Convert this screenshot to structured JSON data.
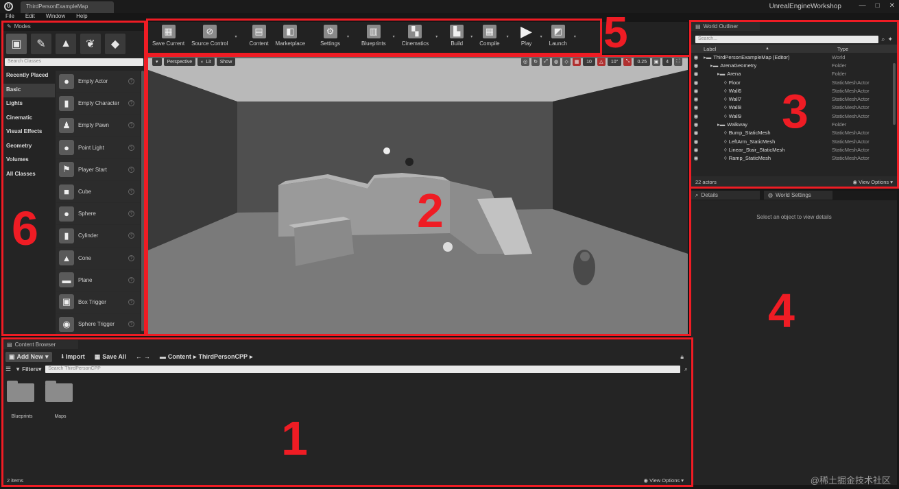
{
  "window": {
    "doc_tab": "ThirdPersonExampleMap",
    "title": "UnrealEngineWorkshop",
    "controls": [
      "—",
      "□",
      "✕"
    ]
  },
  "menu": [
    "File",
    "Edit",
    "Window",
    "Help"
  ],
  "modes": {
    "tab_label": "Modes",
    "search_placeholder": "Search Classes",
    "categories": [
      "Recently Placed",
      "Basic",
      "Lights",
      "Cinematic",
      "Visual Effects",
      "Geometry",
      "Volumes",
      "All Classes"
    ],
    "items": [
      "Empty Actor",
      "Empty Character",
      "Empty Pawn",
      "Point Light",
      "Player Start",
      "Cube",
      "Sphere",
      "Cylinder",
      "Cone",
      "Plane",
      "Box Trigger",
      "Sphere Trigger"
    ]
  },
  "toolbar": {
    "items": [
      "Save Current",
      "Source Control",
      "Content",
      "Marketplace",
      "Settings",
      "Blueprints",
      "Cinematics",
      "Build",
      "Compile",
      "Play",
      "Launch"
    ]
  },
  "viewport": {
    "perspective": "Perspective",
    "lit": "Lit",
    "show": "Show",
    "grid_snap": "10",
    "rot_snap": "10°",
    "scale_snap": "0.25",
    "camera_speed": "4"
  },
  "outliner": {
    "tab_label": "World Outliner",
    "search_placeholder": "Search...",
    "col_label": "Label",
    "col_type": "Type",
    "rows": [
      {
        "label": "ThirdPersonExampleMap (Editor)",
        "type": "World",
        "indent": 0
      },
      {
        "label": "ArenaGeometry",
        "type": "Folder",
        "indent": 1
      },
      {
        "label": "Arena",
        "type": "Folder",
        "indent": 2
      },
      {
        "label": "Floor",
        "type": "StaticMeshActor",
        "indent": 3
      },
      {
        "label": "Wall6",
        "type": "StaticMeshActor",
        "indent": 3
      },
      {
        "label": "Wall7",
        "type": "StaticMeshActor",
        "indent": 3
      },
      {
        "label": "Wall8",
        "type": "StaticMeshActor",
        "indent": 3
      },
      {
        "label": "Wall9",
        "type": "StaticMeshActor",
        "indent": 3
      },
      {
        "label": "Walkway",
        "type": "Folder",
        "indent": 2
      },
      {
        "label": "Bump_StaticMesh",
        "type": "StaticMeshActor",
        "indent": 3
      },
      {
        "label": "LeftArm_StaticMesh",
        "type": "StaticMeshActor",
        "indent": 3
      },
      {
        "label": "Linear_Stair_StaticMesh",
        "type": "StaticMeshActor",
        "indent": 3
      },
      {
        "label": "Ramp_StaticMesh",
        "type": "StaticMeshActor",
        "indent": 3
      }
    ],
    "actor_count": "22 actors",
    "view_options": "View Options"
  },
  "details": {
    "tab_details": "Details",
    "tab_world_settings": "World Settings",
    "empty_message": "Select an object to view details"
  },
  "content_browser": {
    "tab_label": "Content Browser",
    "add_new": "Add New",
    "import": "Import",
    "save_all": "Save All",
    "path": [
      "Content",
      "ThirdPersonCPP"
    ],
    "filters": "Filters",
    "search_placeholder": "Search ThirdPersonCPP",
    "folders": [
      "Blueprints",
      "Maps"
    ],
    "item_count": "2 items",
    "view_options": "View Options"
  },
  "annotations": [
    "1",
    "2",
    "3",
    "4",
    "5",
    "6"
  ],
  "watermark": "@稀土掘金技术社区",
  "colors": {
    "annotation_red": "#ef1c24",
    "panel": "#242424",
    "background": "#161616"
  }
}
